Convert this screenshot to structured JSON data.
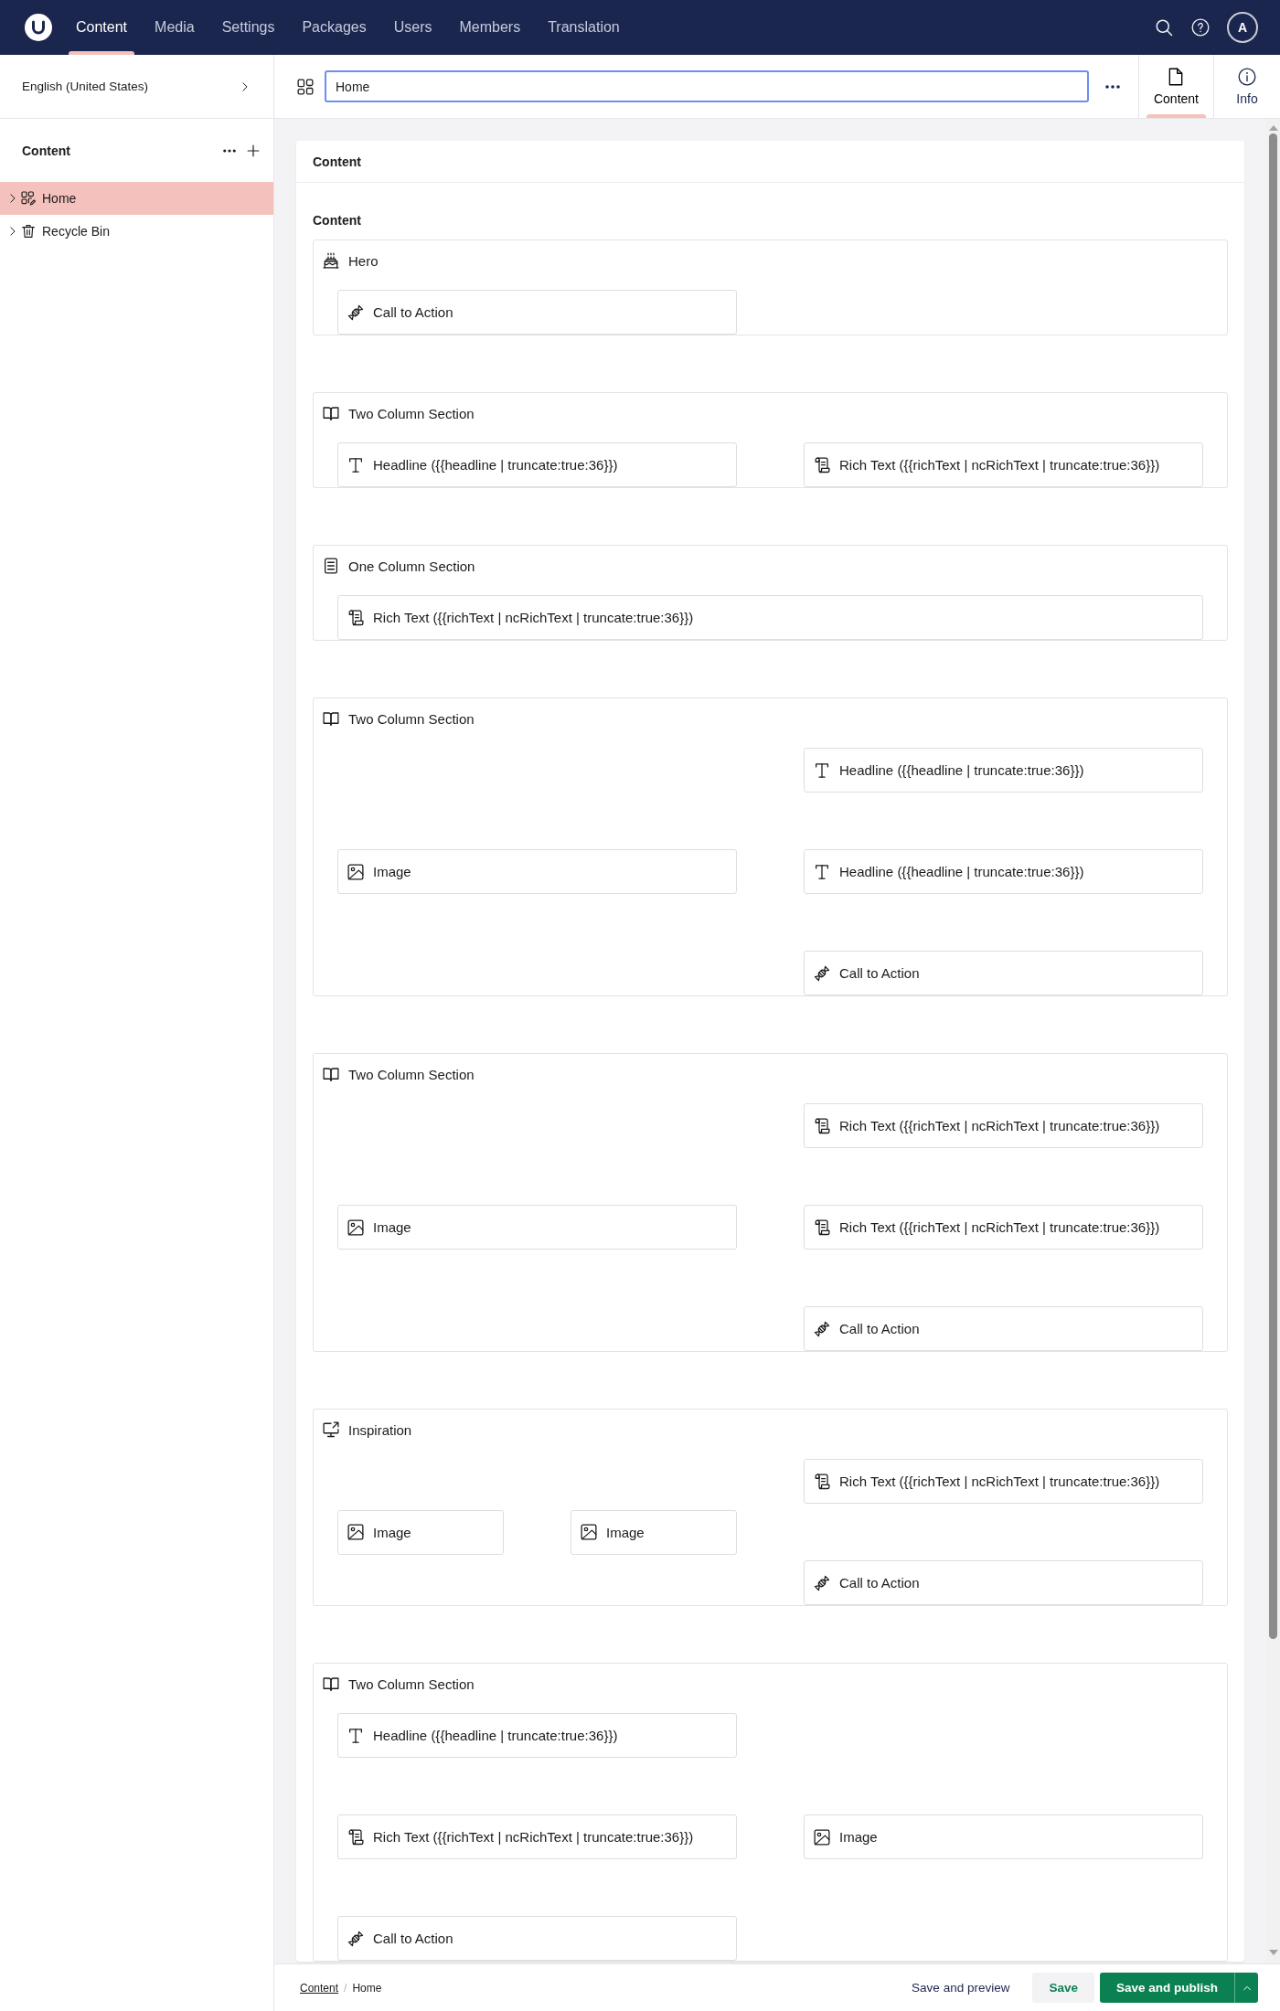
{
  "top_bar": {
    "tabs": [
      {
        "label": "Content",
        "selected": true
      },
      {
        "label": "Media",
        "selected": false
      },
      {
        "label": "Settings",
        "selected": false
      },
      {
        "label": "Packages",
        "selected": false
      },
      {
        "label": "Users",
        "selected": false
      },
      {
        "label": "Members",
        "selected": false
      },
      {
        "label": "Translation",
        "selected": false
      }
    ],
    "avatar": "A"
  },
  "sidebar": {
    "language": "English (United States)",
    "section_title": "Content",
    "tree": [
      {
        "kind": "page",
        "label": "Home",
        "selected": true,
        "expanded": false
      },
      {
        "kind": "recycle_bin",
        "label": "Recycle Bin",
        "selected": false,
        "expanded": false
      }
    ]
  },
  "editor": {
    "name": "Home",
    "views": [
      {
        "kind": "content",
        "label": "Content",
        "selected": true
      },
      {
        "kind": "info",
        "label": "Info",
        "selected": false
      }
    ]
  },
  "content": {
    "group_title": "Content",
    "property_label": "Content",
    "blocks": [
      {
        "kind": "hero",
        "title": "Hero",
        "areas": [
          {
            "items": [
              {
                "kind": "cta",
                "label": "Call to Action"
              }
            ]
          }
        ]
      },
      {
        "kind": "two_column",
        "title": "Two Column Section",
        "areas": [
          {
            "items": [
              {
                "kind": "headline",
                "label": "Headline ({{headline | truncate:true:36}})"
              }
            ]
          },
          {
            "items": [
              {
                "kind": "rich_text",
                "label": "Rich Text ({{richText | ncRichText | truncate:true:36}})"
              }
            ]
          }
        ]
      },
      {
        "kind": "one_column",
        "title": "One Column Section",
        "areas": [
          {
            "items": [
              {
                "kind": "rich_text",
                "label": "Rich Text ({{richText | ncRichText | truncate:true:36}})"
              }
            ]
          }
        ]
      },
      {
        "kind": "two_column",
        "title": "Two Column Section",
        "areas": [
          {
            "items": [
              {
                "kind": "image",
                "label": "Image"
              }
            ]
          },
          {
            "items": [
              {
                "kind": "headline",
                "label": "Headline ({{headline | truncate:true:36}})"
              },
              {
                "kind": "headline",
                "label": "Headline ({{headline | truncate:true:36}})"
              },
              {
                "kind": "cta",
                "label": "Call to Action"
              }
            ]
          }
        ]
      },
      {
        "kind": "two_column",
        "title": "Two Column Section",
        "areas": [
          {
            "items": [
              {
                "kind": "image",
                "label": "Image"
              }
            ]
          },
          {
            "items": [
              {
                "kind": "rich_text",
                "label": "Rich Text ({{richText | ncRichText | truncate:true:36}})"
              },
              {
                "kind": "rich_text",
                "label": "Rich Text ({{richText | ncRichText | truncate:true:36}})"
              },
              {
                "kind": "cta",
                "label": "Call to Action"
              }
            ]
          }
        ]
      },
      {
        "kind": "inspiration",
        "title": "Inspiration",
        "areas": [
          {
            "items": [
              {
                "kind": "image",
                "label": "Image"
              }
            ]
          },
          {
            "items": [
              {
                "kind": "image",
                "label": "Image"
              }
            ]
          },
          {
            "items": [
              {
                "kind": "rich_text",
                "label": "Rich Text ({{richText | ncRichText | truncate:true:36}})"
              },
              {
                "kind": "cta",
                "label": "Call to Action"
              }
            ]
          }
        ]
      },
      {
        "kind": "two_column",
        "title": "Two Column Section",
        "areas": [
          {
            "items": [
              {
                "kind": "headline",
                "label": "Headline ({{headline | truncate:true:36}})"
              },
              {
                "kind": "rich_text",
                "label": "Rich Text ({{richText | ncRichText | truncate:true:36}})"
              },
              {
                "kind": "cta",
                "label": "Call to Action"
              }
            ]
          },
          {
            "items": [
              {
                "kind": "image",
                "label": "Image"
              }
            ]
          }
        ]
      }
    ]
  },
  "footer": {
    "breadcrumb": [
      {
        "label": "Content",
        "current": false
      },
      {
        "label": "Home",
        "current": true
      }
    ],
    "separator": "/",
    "actions": [
      {
        "kind": "preview",
        "label": "Save and preview"
      },
      {
        "kind": "save",
        "label": "Save"
      },
      {
        "kind": "publish",
        "label": "Save and publish"
      }
    ]
  }
}
